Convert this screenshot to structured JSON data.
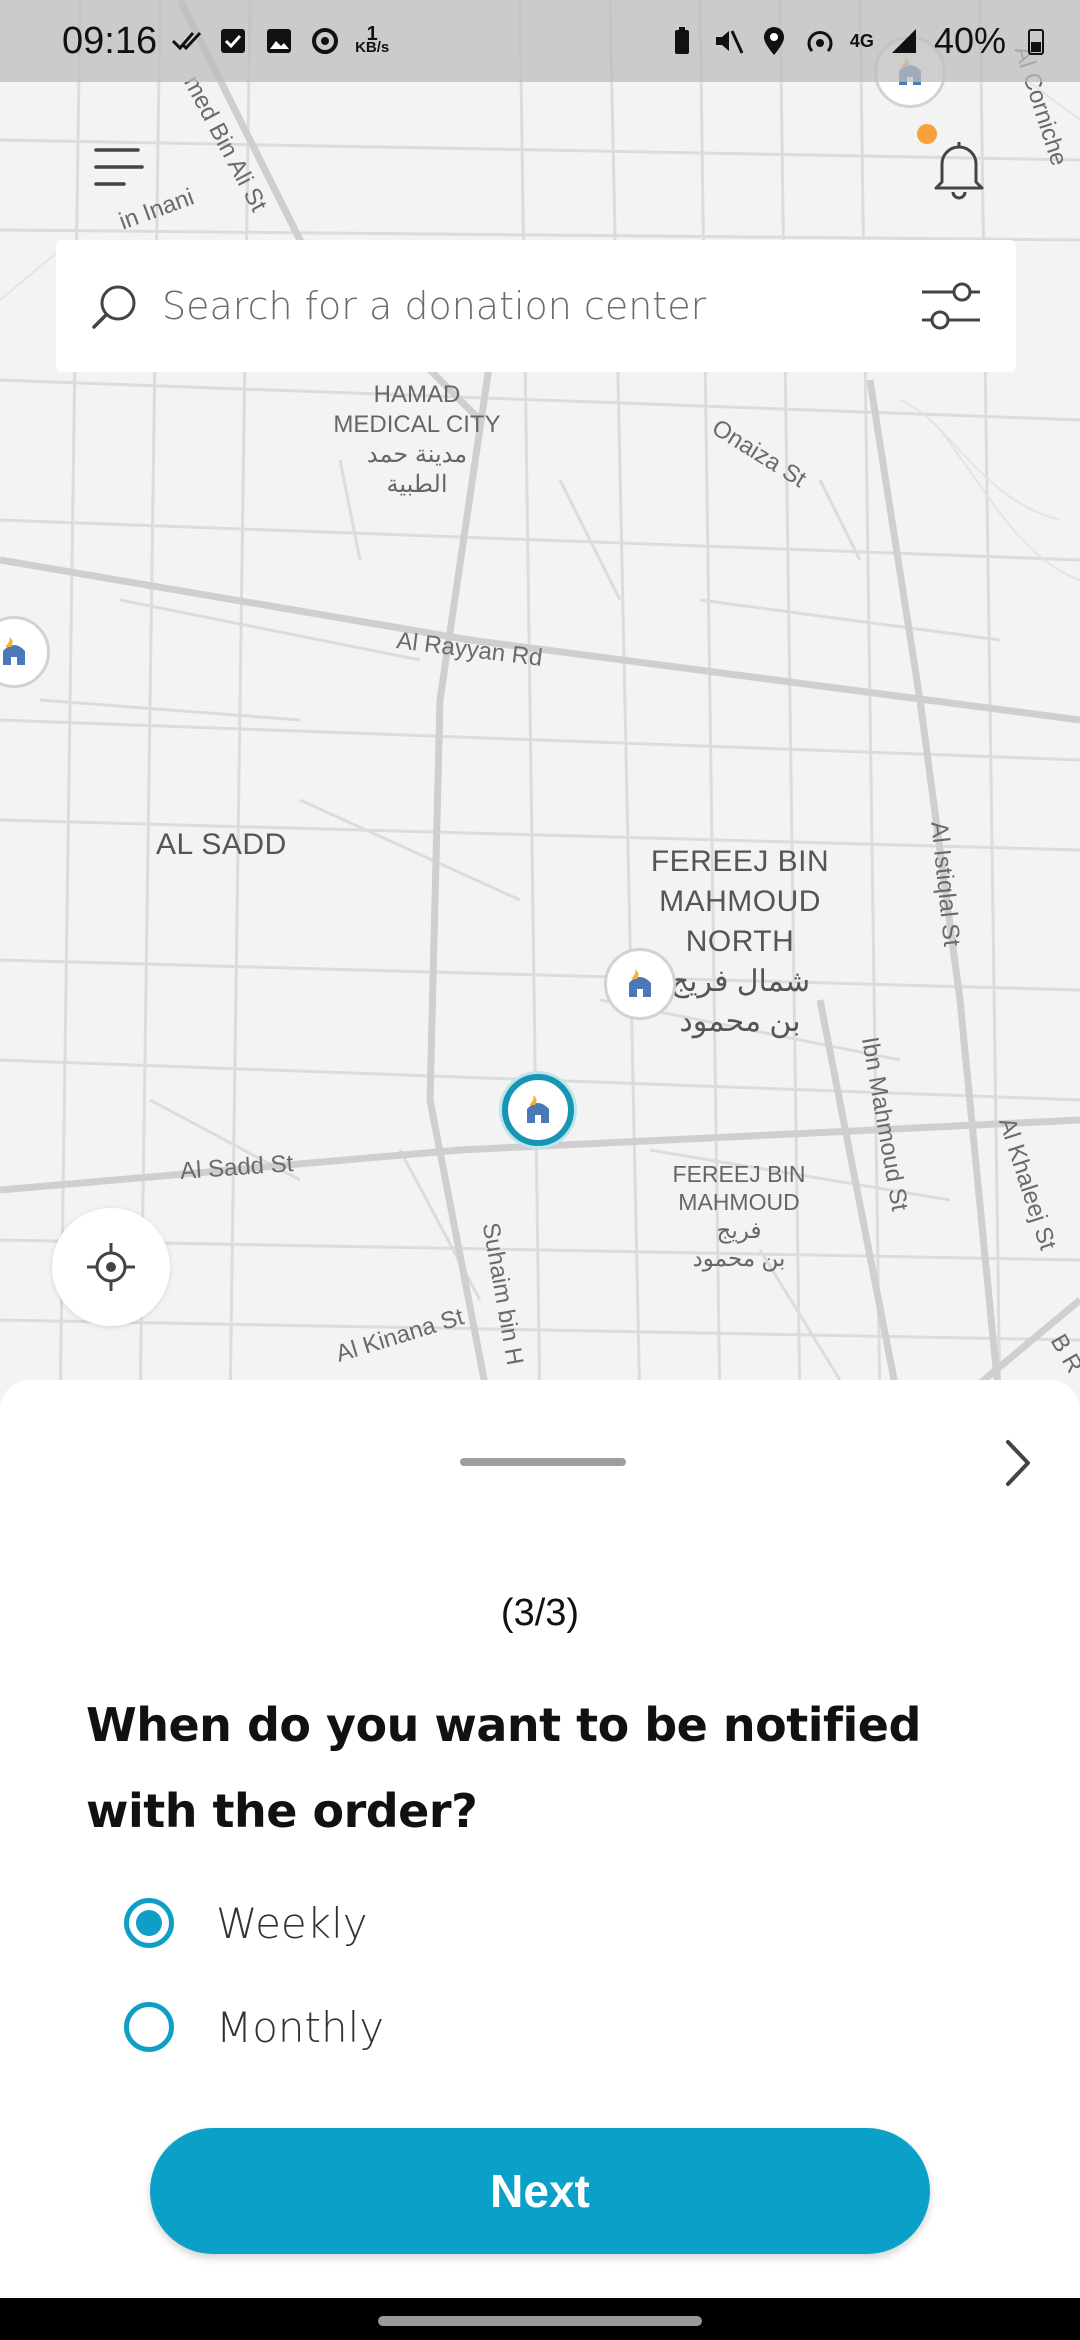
{
  "status_bar": {
    "time": "09:16",
    "net_speed_value": "1",
    "net_speed_unit": "KB/s",
    "network": "4G",
    "battery": "40%"
  },
  "map": {
    "labels": {
      "hamad_line1": "HAMAD",
      "hamad_line2": "MEDICAL CITY",
      "hamad_ar1": "مدينة حمد",
      "hamad_ar2": "الطبية",
      "onaiza": "Onaiza St",
      "al_rayyan": "Al Rayyan Rd",
      "al_sadd_area": "AL SADD",
      "fereej_north1": "FEREEJ BIN",
      "fereej_north2": "MAHMOUD",
      "fereej_north3": "NORTH",
      "fereej_north_ar1": "شمال فريج",
      "fereej_north_ar2": "بن محمود",
      "fereej1": "FEREEJ BIN",
      "fereej2": "MAHMOUD",
      "fereej_ar1": "فريج",
      "fereej_ar2": "بن محمود",
      "al_istiqlal": "Al Istiqlal St",
      "ibn_mahmoud": "Ibn Mahmoud St",
      "al_khaleej": "Al Khaleej St",
      "al_sadd_st": "Al Sadd St",
      "suhaim": "Suhaim bin H",
      "al_kinana": "Al Kinana St",
      "ali_st": "med Bin Ali St",
      "ali_inani": "in Inani",
      "corniche": "Al Corniche",
      "b_r": "B R"
    }
  },
  "search": {
    "placeholder": "Search for a donation center"
  },
  "sheet": {
    "step": "(3/3)",
    "question": "When do you want to be notified with the order?",
    "options": [
      {
        "label": "Weekly",
        "selected": true
      },
      {
        "label": "Monthly",
        "selected": false
      }
    ],
    "next_label": "Next"
  },
  "colors": {
    "accent": "#0ba0c8",
    "badge": "#f7a13b",
    "selected_marker": "#1796b4"
  },
  "icons": {
    "menu": "menu-icon",
    "bell": "bell-icon",
    "search": "search-icon",
    "filter": "filter-sliders-icon",
    "locate": "crosshair-icon",
    "marker": "mosque-icon",
    "chevron": "chevron-right-icon"
  }
}
